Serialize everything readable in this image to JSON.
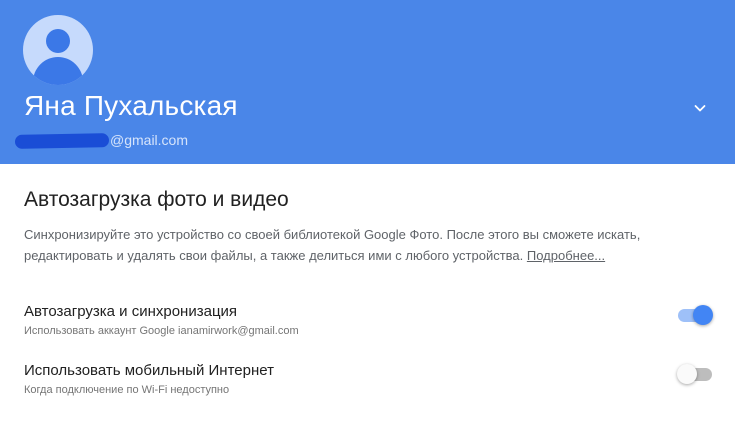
{
  "account": {
    "name": "Яна Пухальская",
    "email_domain": "@gmail.com",
    "header_color": "#4a86e8",
    "expand_icon": "chevron-down-icon"
  },
  "autoupload": {
    "title": "Автозагрузка фото и видео",
    "description": "Синхронизируйте это устройство со своей библиотекой Google Фото. После этого вы сможете искать, редактировать и удалять свои файлы, а также делиться ими с любого устройства. ",
    "learn_more": "Подробнее..."
  },
  "settings": [
    {
      "title": "Автозагрузка и синхронизация",
      "subtitle": "Использовать аккаунт Google ianamirwork@gmail.com",
      "enabled": true
    },
    {
      "title": "Использовать мобильный Интернет",
      "subtitle": "Когда подключение по Wi-Fi недоступно",
      "enabled": false
    }
  ],
  "colors": {
    "accent": "#4285f4",
    "accent_track": "#9ec0f8",
    "off_track": "#bdbdbd"
  }
}
